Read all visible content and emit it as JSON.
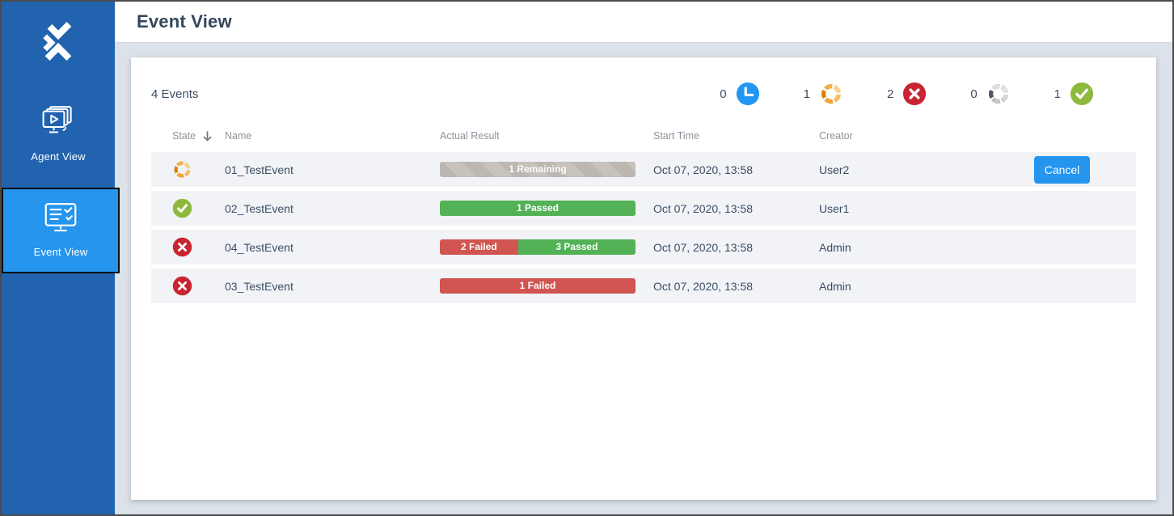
{
  "sidebar": {
    "items": [
      {
        "label": "Agent View",
        "active": false
      },
      {
        "label": "Event View",
        "active": true
      }
    ]
  },
  "header": {
    "title": "Event View"
  },
  "summary": {
    "events_count": "4 Events",
    "counters": [
      {
        "name": "waiting",
        "count": "0"
      },
      {
        "name": "running",
        "count": "1"
      },
      {
        "name": "failed",
        "count": "2"
      },
      {
        "name": "in-progress",
        "count": "0"
      },
      {
        "name": "passed",
        "count": "1"
      }
    ]
  },
  "table": {
    "columns": {
      "state": "State",
      "name": "Name",
      "result": "Actual Result",
      "start": "Start Time",
      "creator": "Creator"
    },
    "sort": {
      "column": "State",
      "direction": "descending"
    },
    "rows": [
      {
        "state": "running",
        "name": "01_TestEvent",
        "segments": [
          {
            "type": "remaining",
            "label": "1 Remaining",
            "count": 1
          }
        ],
        "start": "Oct 07, 2020, 13:58",
        "creator": "User2",
        "action": "Cancel"
      },
      {
        "state": "passed",
        "name": "02_TestEvent",
        "segments": [
          {
            "type": "passed",
            "label": "1 Passed",
            "count": 1
          }
        ],
        "start": "Oct 07, 2020, 13:58",
        "creator": "User1"
      },
      {
        "state": "failed",
        "name": "04_TestEvent",
        "segments": [
          {
            "type": "failed",
            "label": "2 Failed",
            "count": 2
          },
          {
            "type": "passed",
            "label": "3 Passed",
            "count": 3
          }
        ],
        "start": "Oct 07, 2020, 13:58",
        "creator": "Admin"
      },
      {
        "state": "failed",
        "name": "03_TestEvent",
        "segments": [
          {
            "type": "failed",
            "label": "1 Failed",
            "count": 1
          }
        ],
        "start": "Oct 07, 2020, 13:58",
        "creator": "Admin"
      }
    ]
  },
  "colors": {
    "sidebar_blue": "#2163ae",
    "active_item_blue": "#2595ee",
    "accent_blue": "#2196f3",
    "passed_green": "#53b156",
    "failed_red": "#d15450",
    "remaining_gray": "#bcb7b1",
    "state_error_red": "#c92432",
    "state_success_green": "#8fb93c",
    "running_orange": "#e8940f",
    "text_dark": "#3b4d63",
    "text_muted": "#8b949d"
  }
}
